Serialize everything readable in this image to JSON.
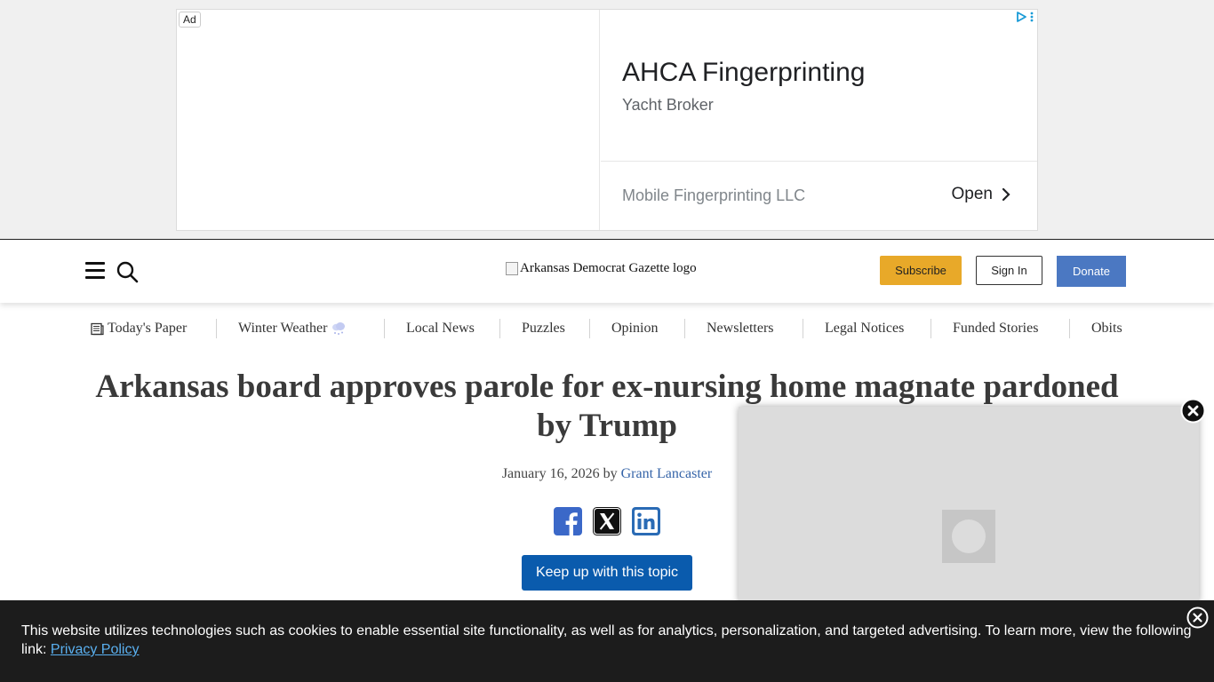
{
  "ad": {
    "label": "Ad",
    "headline": "AHCA Fingerprinting",
    "subtitle": "Yacht Broker",
    "advertiser": "Mobile Fingerprinting LLC",
    "cta": "Open"
  },
  "header": {
    "logo_alt": "Arkansas Democrat Gazette logo",
    "subscribe_label": "Subscribe",
    "signin_label": "Sign In",
    "donate_label": "Donate"
  },
  "nav": {
    "items": [
      {
        "label": "Today's Paper",
        "icon": "newspaper-icon"
      },
      {
        "label": "Winter Weather",
        "icon": "snow-cloud-icon"
      },
      {
        "label": "Local News"
      },
      {
        "label": "Puzzles"
      },
      {
        "label": "Opinion"
      },
      {
        "label": "Newsletters"
      },
      {
        "label": "Legal Notices"
      },
      {
        "label": "Funded Stories"
      },
      {
        "label": "Obits"
      }
    ]
  },
  "article": {
    "headline": "Arkansas board approves parole for ex-nursing home magnate pardoned by Trump",
    "date": "January 16, 2026",
    "by": "by",
    "author": "Grant Lancaster",
    "keep_up_label": "Keep up with this topic"
  },
  "share": {
    "icons": [
      "facebook-icon",
      "x-icon",
      "linkedin-icon"
    ]
  },
  "colors": {
    "subscribe": "#e8a929",
    "donate": "#4b78c2",
    "keep_up": "#0a5bad",
    "facebook": "#3b68c8",
    "linkedin": "#2a6bb5",
    "link": "#3564a8"
  },
  "cookie": {
    "text": "This website utilizes technologies such as cookies to enable essential site functionality, as well as for analytics, personalization, and targeted advertising. To learn more, view the following link: ",
    "link_label": "Privacy Policy"
  }
}
